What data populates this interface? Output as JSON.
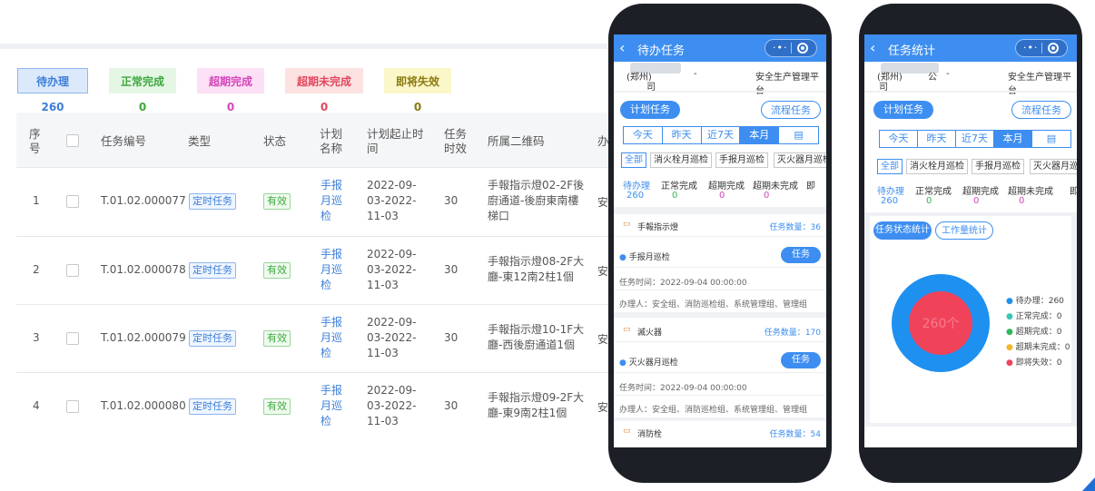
{
  "status_pills": [
    {
      "label": "待办理260",
      "bg": "#dbe9fb",
      "fg": "#3d7ed8",
      "border": "#8fb7ee"
    },
    {
      "label": "正常完成0",
      "bg": "#e5f6e5",
      "fg": "#3da83d",
      "border": "#e5f6e5"
    },
    {
      "label": "超期完成0",
      "bg": "#fbe0f6",
      "fg": "#d446b8",
      "border": "#fbe0f6"
    },
    {
      "label": "超期未完成0",
      "bg": "#fde2e2",
      "fg": "#e0485f",
      "border": "#fde2e2"
    },
    {
      "label": "即将失效0",
      "bg": "#fbf7c8",
      "fg": "#8a7a10",
      "border": "#fbf7c8"
    }
  ],
  "table": {
    "headers": {
      "index": [
        "序",
        "号"
      ],
      "code": "任务编号",
      "type": "类型",
      "state": "状态",
      "plan_name": [
        "计划",
        "名称"
      ],
      "period": [
        "计划起止时",
        "间"
      ],
      "effect": [
        "任务",
        "时效"
      ],
      "qr": "所属二维码",
      "more": "办"
    },
    "rows": [
      {
        "index": "1",
        "code": "T.01.02.000077",
        "type": "定时任务",
        "state": "有效",
        "plan": [
          "手报",
          "月巡",
          "检"
        ],
        "period": [
          "2022-09-",
          "03-2022-",
          "11-03"
        ],
        "effect": "30",
        "qr": [
          "手報指示燈02-2F後",
          "廚通道-後廚東南樓",
          "梯口"
        ],
        "more": "安"
      },
      {
        "index": "2",
        "code": "T.01.02.000078",
        "type": "定时任务",
        "state": "有效",
        "plan": [
          "手报",
          "月巡",
          "检"
        ],
        "period": [
          "2022-09-",
          "03-2022-",
          "11-03"
        ],
        "effect": "30",
        "qr": [
          "手報指示燈08-2F大",
          "廳-東12南2柱1個"
        ],
        "more": "安"
      },
      {
        "index": "3",
        "code": "T.01.02.000079",
        "type": "定时任务",
        "state": "有效",
        "plan": [
          "手报",
          "月巡",
          "检"
        ],
        "period": [
          "2022-09-",
          "03-2022-",
          "11-03"
        ],
        "effect": "30",
        "qr": [
          "手報指示燈10-1F大",
          "廳-西後廚通道1個"
        ],
        "more": "安"
      },
      {
        "index": "4",
        "code": "T.01.02.000080",
        "type": "定时任务",
        "state": "有效",
        "plan": [
          "手报",
          "月巡",
          "检"
        ],
        "period": [
          "2022-09-",
          "03-2022-",
          "11-03"
        ],
        "effect": "30",
        "qr": [
          "手報指示燈09-2F大",
          "廳-東9南2柱1個"
        ],
        "more": "安"
      }
    ]
  },
  "phone1": {
    "title": "待办任务",
    "org_left": "(郑州)",
    "org_sub": "司",
    "org_dash": "-",
    "platform": "安全生产管理平台",
    "btn_plan": "计划任务",
    "btn_flow": "流程任务",
    "periods": [
      "今天",
      "昨天",
      "近7天",
      "本月"
    ],
    "chips": [
      "全部",
      "消火栓月巡检",
      "手报月巡检",
      "灭火器月巡检"
    ],
    "counts": [
      {
        "label": "待办理",
        "value": "260"
      },
      {
        "label": "正常完成",
        "value": "0"
      },
      {
        "label": "超期完成",
        "value": "0"
      },
      {
        "label": "超期未完成",
        "value": "0"
      },
      {
        "label": "即",
        "value": ""
      }
    ],
    "groups": [
      {
        "name": "手報指示燈",
        "qty_label": "任务数量：",
        "qty": "36",
        "task": "手报月巡检",
        "btn": "任务",
        "time_label": "任务时间：",
        "time": "2022-09-04 00:00:00",
        "handler_label": "办理人：",
        "handler": "安全组、消防巡检组、系统管理组、管理组"
      },
      {
        "name": "滅火器",
        "qty_label": "任务数量：",
        "qty": "170",
        "task": "灭火器月巡检",
        "btn": "任务",
        "time_label": "任务时间：",
        "time": "2022-09-04 00:00:00",
        "handler_label": "办理人：",
        "handler": "安全组、消防巡检组、系统管理组、管理组"
      },
      {
        "name": "消防栓",
        "qty_label": "任务数量：",
        "qty": "54"
      }
    ]
  },
  "phone2": {
    "title": "任务统计",
    "org_left": "(郑州)",
    "org_mid": "公",
    "org_sub": "司",
    "org_dash": "-",
    "platform": "安全生产管理平台",
    "btn_plan": "计划任务",
    "btn_flow": "流程任务",
    "periods": [
      "今天",
      "昨天",
      "近7天",
      "本月"
    ],
    "chips": [
      "全部",
      "消火栓月巡检",
      "手报月巡检",
      "灭火器月巡检"
    ],
    "counts": [
      {
        "label": "待办理",
        "value": "260"
      },
      {
        "label": "正常完成",
        "value": "0"
      },
      {
        "label": "超期完成",
        "value": "0"
      },
      {
        "label": "超期未完成",
        "value": "0"
      },
      {
        "label": "即",
        "value": ""
      }
    ],
    "tab_status": "任务状态统计",
    "tab_work": "工作量统计",
    "donut_center": "260个",
    "legend": [
      {
        "label": "待办理：260",
        "color": "#1e90f0"
      },
      {
        "label": "正常完成：0",
        "color": "#36c7b8"
      },
      {
        "label": "超期完成：0",
        "color": "#2fb85a"
      },
      {
        "label": "超期未完成：0",
        "color": "#f2b72a"
      },
      {
        "label": "即将失效：0",
        "color": "#f0435a"
      }
    ]
  },
  "colors": {
    "accent": "#3d8ef0",
    "link": "#3d7ed8"
  }
}
